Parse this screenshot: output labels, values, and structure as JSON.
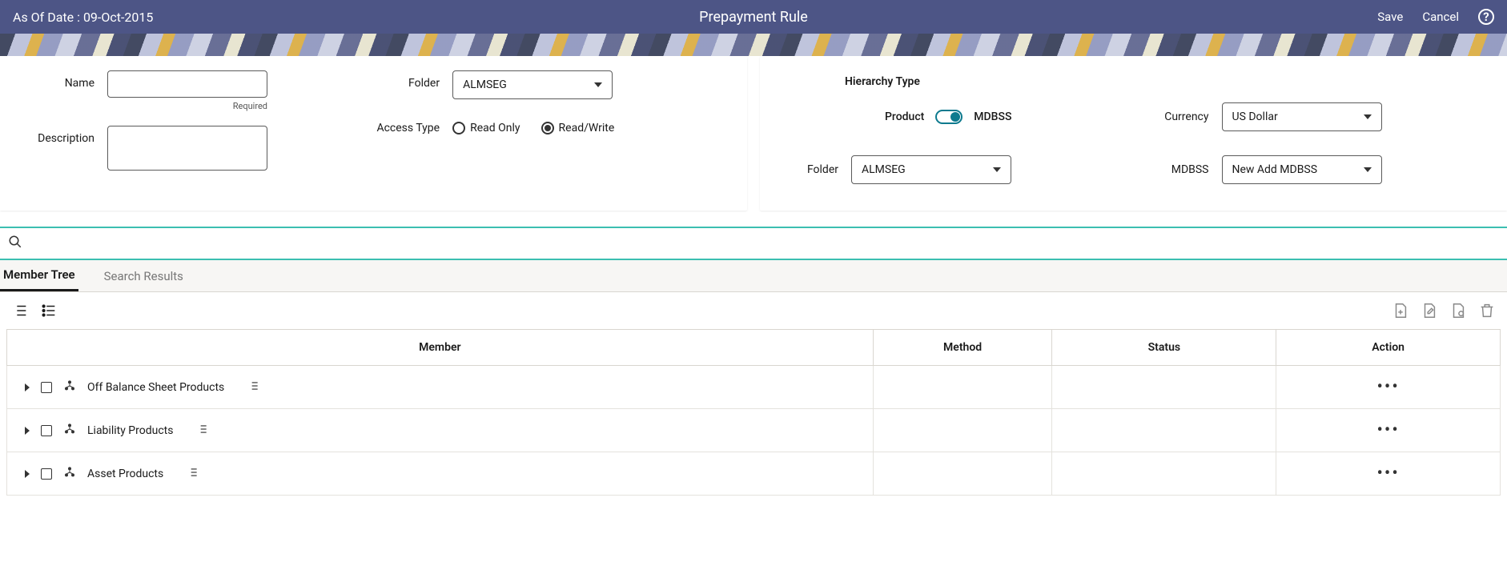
{
  "header": {
    "as_of_label": "As Of Date : 09-Oct-2015",
    "title": "Prepayment Rule",
    "save": "Save",
    "cancel": "Cancel"
  },
  "left_form": {
    "name_label": "Name",
    "name_value": "",
    "required": "Required",
    "desc_label": "Description",
    "desc_value": "",
    "folder_label": "Folder",
    "folder_value": "ALMSEG",
    "access_label": "Access Type",
    "access_readonly": "Read Only",
    "access_readwrite": "Read/Write",
    "access_selected": "readwrite"
  },
  "right_form": {
    "heading": "Hierarchy Type",
    "toggle_left": "Product",
    "toggle_right": "MDBSS",
    "currency_label": "Currency",
    "currency_value": "US Dollar",
    "folder_label": "Folder",
    "folder_value": "ALMSEG",
    "mdbss_label": "MDBSS",
    "mdbss_value": "New Add MDBSS"
  },
  "tabs": {
    "member_tree": "Member Tree",
    "search_results": "Search Results"
  },
  "table": {
    "headers": {
      "member": "Member",
      "method": "Method",
      "status": "Status",
      "action": "Action"
    },
    "rows": [
      {
        "label": "Off Balance Sheet Products"
      },
      {
        "label": "Liability Products"
      },
      {
        "label": "Asset Products"
      }
    ]
  }
}
